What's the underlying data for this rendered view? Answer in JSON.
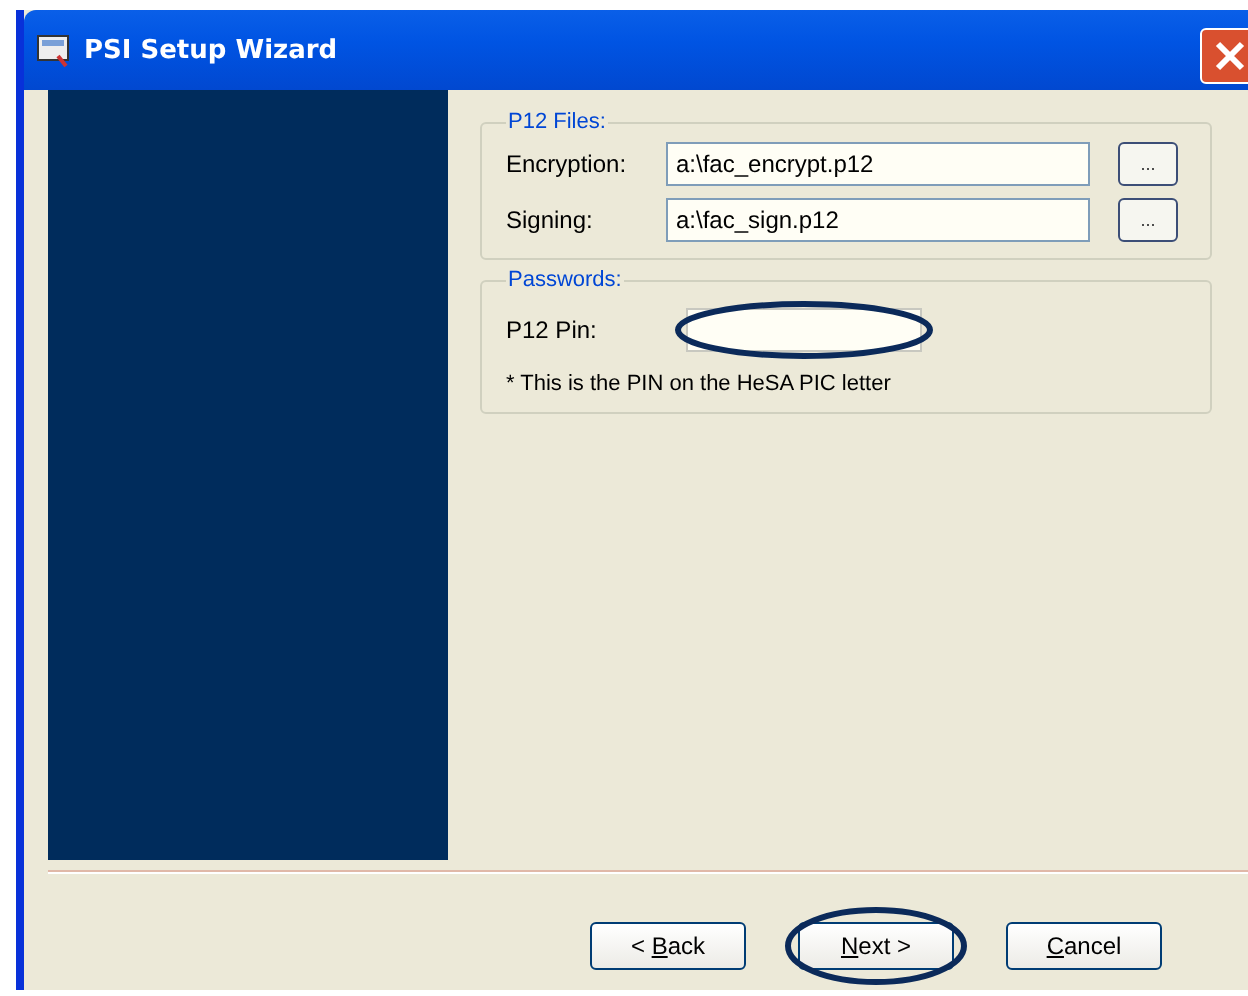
{
  "window": {
    "title": "PSI Setup Wizard"
  },
  "p12_files": {
    "legend": "P12 Files:",
    "rows": [
      {
        "label": "Encryption:",
        "value": "a:\\fac_encrypt.p12",
        "browse": "..."
      },
      {
        "label": "Signing:",
        "value": "a:\\fac_sign.p12",
        "browse": "..."
      }
    ]
  },
  "passwords": {
    "legend": "Passwords:",
    "pin_label": "P12 Pin:",
    "note": "* This is the PIN on the HeSA PIC letter",
    "pin_highlighted": true
  },
  "buttons": [
    {
      "before": "< ",
      "key": "B",
      "after": "ack",
      "highlighted": false
    },
    {
      "key": "N",
      "after": "ext >",
      "highlighted": true
    },
    {
      "key": "C",
      "after": "ancel",
      "highlighted": false
    }
  ]
}
